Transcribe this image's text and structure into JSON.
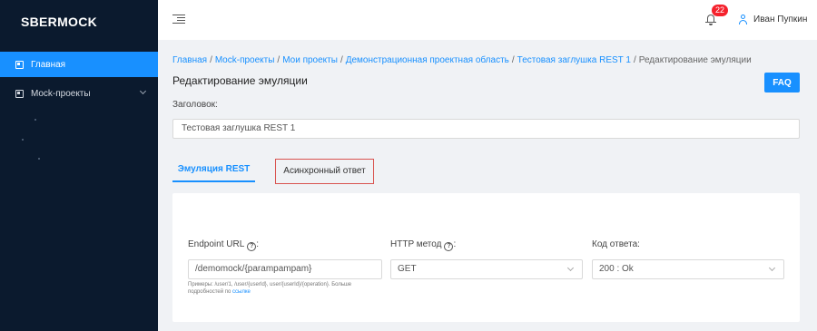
{
  "app": {
    "logo": "SBERMOCK"
  },
  "sidebar": {
    "items": [
      {
        "label": "Главная",
        "icon": "home-icon",
        "active": true
      },
      {
        "label": "Mock-проекты",
        "icon": "projects-icon",
        "active": false
      }
    ]
  },
  "header": {
    "notifications_count": "22",
    "user_name": "Иван Пупкин"
  },
  "breadcrumb": {
    "items": [
      "Главная",
      "Mock-проекты",
      "Мои проекты",
      "Демонстрационная проектная область",
      "Тестовая заглушка REST 1"
    ],
    "current": "Редактирование эмуляции",
    "separator": "/"
  },
  "page": {
    "title": "Редактирование эмуляции",
    "faq_label": "FAQ",
    "title_field_label": "Заголовок:",
    "title_field_value": "Тестовая заглушка REST 1"
  },
  "tabs": [
    {
      "label": "Эмуляция REST",
      "active": true
    },
    {
      "label": "Асинхронный ответ",
      "active": false
    }
  ],
  "form": {
    "endpoint_label": "Endpoint URL",
    "endpoint_value": "/demomock/{parampampam}",
    "endpoint_hint": "Примеры: /user/1, /user/{userId}, user/{userId}/{operation}. Больше подробностей по",
    "endpoint_hint_link": "ссылке",
    "method_label": "HTTP метод",
    "method_value": "GET",
    "status_label": "Код ответа:",
    "status_value": "200 : Ok",
    "colon": ":",
    "help_glyph": "?"
  },
  "colors": {
    "accent": "#1890ff",
    "sidebar_bg": "#0b1a2e",
    "highlight": "#d9534f",
    "badge": "#f5222d"
  }
}
